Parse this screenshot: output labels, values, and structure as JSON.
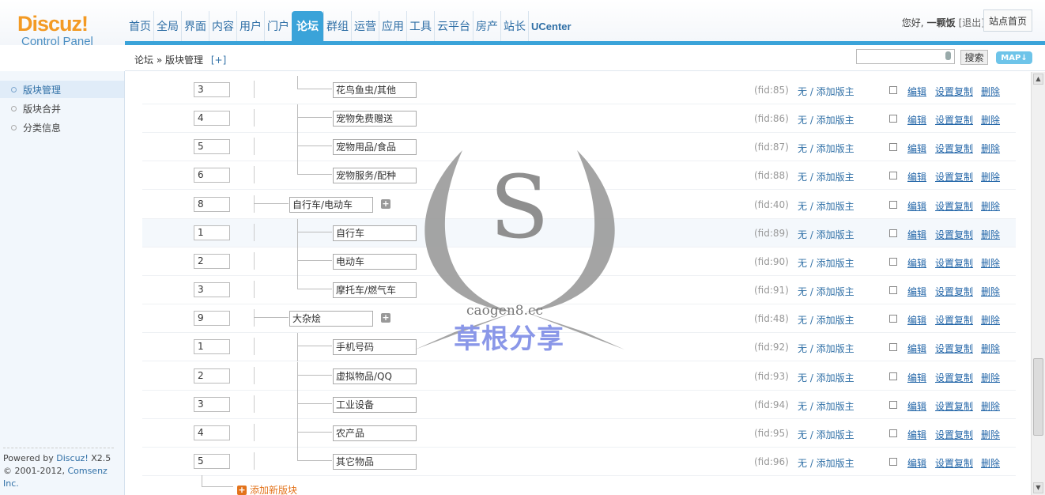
{
  "logo": {
    "brand": "Discuz!",
    "sub": "Control Panel"
  },
  "nav": [
    "首页",
    "全局",
    "界面",
    "内容",
    "用户",
    "门户",
    "论坛",
    "群组",
    "运营",
    "应用",
    "工具",
    "云平台",
    "房产",
    "站长",
    "UCenter"
  ],
  "nav_active": "论坛",
  "user": {
    "greeting": "您好,",
    "name": "一颗饭",
    "logout": "[退出]"
  },
  "home_button": "站点首页",
  "breadcrumb": {
    "section": "论坛",
    "sep": "»",
    "page": "版块管理",
    "add": "[+]"
  },
  "search": {
    "button": "搜索",
    "value": ""
  },
  "map_button": "MAP",
  "sidebar": {
    "items": [
      "版块管理",
      "版块合并",
      "分类信息"
    ],
    "active": "版块管理"
  },
  "footer": {
    "powered_prefix": "Powered by ",
    "powered_product": "Discuz!",
    "powered_version": " X2.5",
    "copyright_prefix": "© 2001-2012, ",
    "copyright_company": "Comsenz Inc."
  },
  "forum_rows": [
    {
      "order": "3",
      "name": "花鸟鱼虫/其他",
      "fid": "(fid:85)",
      "level": 2,
      "last": true
    },
    {
      "order": "4",
      "name": "宠物免费赠送",
      "fid": "(fid:86)",
      "level": 2,
      "last": false
    },
    {
      "order": "5",
      "name": "宠物用品/食品",
      "fid": "(fid:87)",
      "level": 2,
      "last": false
    },
    {
      "order": "6",
      "name": "宠物服务/配种",
      "fid": "(fid:88)",
      "level": 2,
      "last": true
    },
    {
      "order": "8",
      "name": "自行车/电动车",
      "fid": "(fid:40)",
      "level": 1,
      "last": false
    },
    {
      "order": "1",
      "name": "自行车",
      "fid": "(fid:89)",
      "level": 2,
      "last": false
    },
    {
      "order": "2",
      "name": "电动车",
      "fid": "(fid:90)",
      "level": 2,
      "last": false
    },
    {
      "order": "3",
      "name": "摩托车/燃气车",
      "fid": "(fid:91)",
      "level": 2,
      "last": true
    },
    {
      "order": "9",
      "name": "大杂烩",
      "fid": "(fid:48)",
      "level": 1,
      "last": false
    },
    {
      "order": "1",
      "name": "手机号码",
      "fid": "(fid:92)",
      "level": 2,
      "last": false
    },
    {
      "order": "2",
      "name": "虚拟物品/QQ",
      "fid": "(fid:93)",
      "level": 2,
      "last": false
    },
    {
      "order": "3",
      "name": "工业设备",
      "fid": "(fid:94)",
      "level": 2,
      "last": false
    },
    {
      "order": "4",
      "name": "农产品",
      "fid": "(fid:95)",
      "level": 2,
      "last": false
    },
    {
      "order": "5",
      "name": "其它物品",
      "fid": "(fid:96)",
      "level": 2,
      "last": true
    }
  ],
  "row_labels": {
    "moderators": "无 / 添加版主",
    "edit": "编辑",
    "copy": "设置复制",
    "delete": "删除",
    "plus": "+"
  },
  "add_new": "添加新版块",
  "watermark": {
    "url": "caogen8.cc",
    "text": "草根分享",
    "letter": "S"
  },
  "colors": {
    "accent": "#3aa3d9",
    "link": "#2366a8",
    "brand": "#f39a24",
    "add": "#e3731b"
  }
}
